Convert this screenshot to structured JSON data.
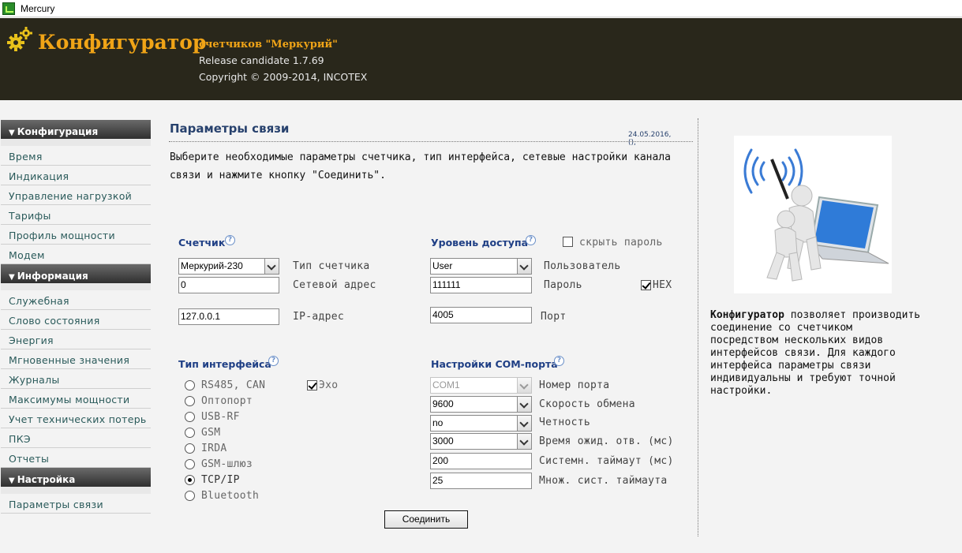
{
  "window": {
    "title": "Mercury"
  },
  "header": {
    "brand": "Конфигуратор",
    "subtitle": "счетчиков \"Меркурий\"",
    "release": "Release candidate 1.7.69",
    "copyright": "Copyright © 2009-2014, INCOTEX"
  },
  "sidebar": {
    "sections": [
      {
        "title": "Конфигурация",
        "items": [
          "Время",
          "Индикация",
          "Управление нагрузкой",
          "Тарифы",
          "Профиль мощности",
          "Модем"
        ]
      },
      {
        "title": "Информация",
        "items": [
          "Служебная",
          "Слово состояния",
          "Энергия",
          "Мгновенные значения",
          "Журналы",
          "Максимумы мощности",
          "Учет технических потерь",
          "ПКЭ",
          "Отчеты"
        ]
      },
      {
        "title": "Настройка",
        "items": [
          "Параметры связи"
        ]
      }
    ]
  },
  "main": {
    "title": "Параметры связи",
    "date": "24.05.2016, (),",
    "intro": "Выберите необходимые параметры счетчика, тип интерфейса, сетевые настройки канала связи и нажмите кнопку \"Соединить\".",
    "meter": {
      "label": "Счетчик",
      "type_value": "Меркурий-230",
      "type_label": "Тип счетчика",
      "address_value": "0",
      "address_label": "Сетевой адрес",
      "ip_value": "127.0.0.1",
      "ip_label": "IP-адрес"
    },
    "access": {
      "label": "Уровень доступа",
      "hide_password_label": "скрыть пароль",
      "hide_password_checked": false,
      "user_value": "User",
      "user_label": "Пользователь",
      "password_value": "111111",
      "password_label": "Пароль",
      "hex_label": "HEX",
      "hex_checked": true,
      "port_value": "4005",
      "port_label": "Порт"
    },
    "interface": {
      "label": "Тип интерфейса",
      "echo_label": "Эхо",
      "echo_checked": true,
      "options": [
        "RS485, CAN",
        "Оптопорт",
        "USB-RF",
        "GSM",
        "IRDA",
        "GSM-шлюз",
        "TCP/IP",
        "Bluetooth"
      ],
      "selected": "TCP/IP"
    },
    "com": {
      "label": "Настройки COM-порта",
      "port_value": "COM1",
      "port_label": "Номер порта",
      "baud_value": "9600",
      "baud_label": "Скорость обмена",
      "parity_value": "no",
      "parity_label": "Четность",
      "wait_value": "3000",
      "wait_label": "Время ожид. отв. (мс)",
      "sys_timeout_value": "200",
      "sys_timeout_label": "Системн. таймаут (мс)",
      "mult_value": "25",
      "mult_label": "Множ. сист. таймаута"
    },
    "connect_button": "Соединить"
  },
  "info": {
    "brand": "Конфигуратор",
    "text": " позволяет производить соединение со счетчиком посредством нескольких видов интерфейсов связи. Для каждого интерфейса параметры связи индивидуальны и требуют точной настройки."
  }
}
